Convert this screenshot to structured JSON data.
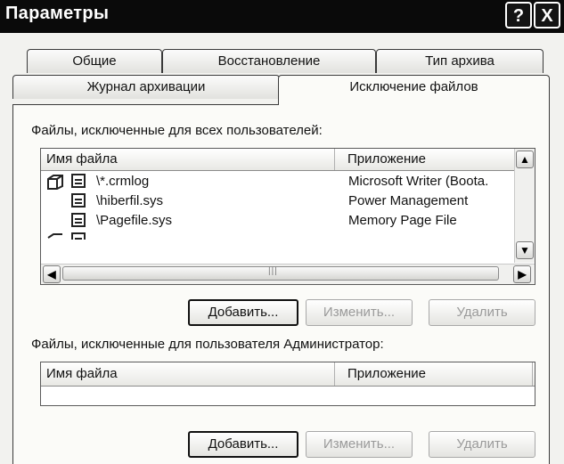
{
  "window": {
    "title": "Параметры",
    "help_label": "?",
    "close_label": "X"
  },
  "tabs": [
    {
      "label": "Общие",
      "active": false
    },
    {
      "label": "Восстановление",
      "active": false
    },
    {
      "label": "Тип архива",
      "active": false
    },
    {
      "label": "Журнал архивации",
      "active": false
    },
    {
      "label": "Исключение файлов",
      "active": true
    }
  ],
  "all_users": {
    "label": "Файлы, исключенные для всех пользователей:",
    "columns": [
      "Имя файла",
      "Приложение"
    ],
    "rows": [
      {
        "name": "\\*.crmlog",
        "app": "Microsoft Writer (Boota."
      },
      {
        "name": "\\hiberfil.sys",
        "app": "Power Management"
      },
      {
        "name": "\\Pagefile.sys",
        "app": "Memory Page File"
      }
    ],
    "buttons": {
      "add": "Добавить...",
      "edit": "Изменить...",
      "delete": "Удалить"
    }
  },
  "current_user": {
    "label": "Файлы, исключенные для пользователя Администратор:",
    "columns": [
      "Имя файла",
      "Приложение"
    ],
    "buttons": {
      "add": "Добавить...",
      "edit": "Изменить...",
      "delete": "Удалить"
    }
  },
  "icons": [
    "help-icon",
    "close-icon",
    "file-group-icon",
    "file-icon",
    "scroll-up-arrow-icon",
    "scroll-down-arrow-icon",
    "scroll-left-arrow-icon",
    "scroll-right-arrow-icon"
  ]
}
